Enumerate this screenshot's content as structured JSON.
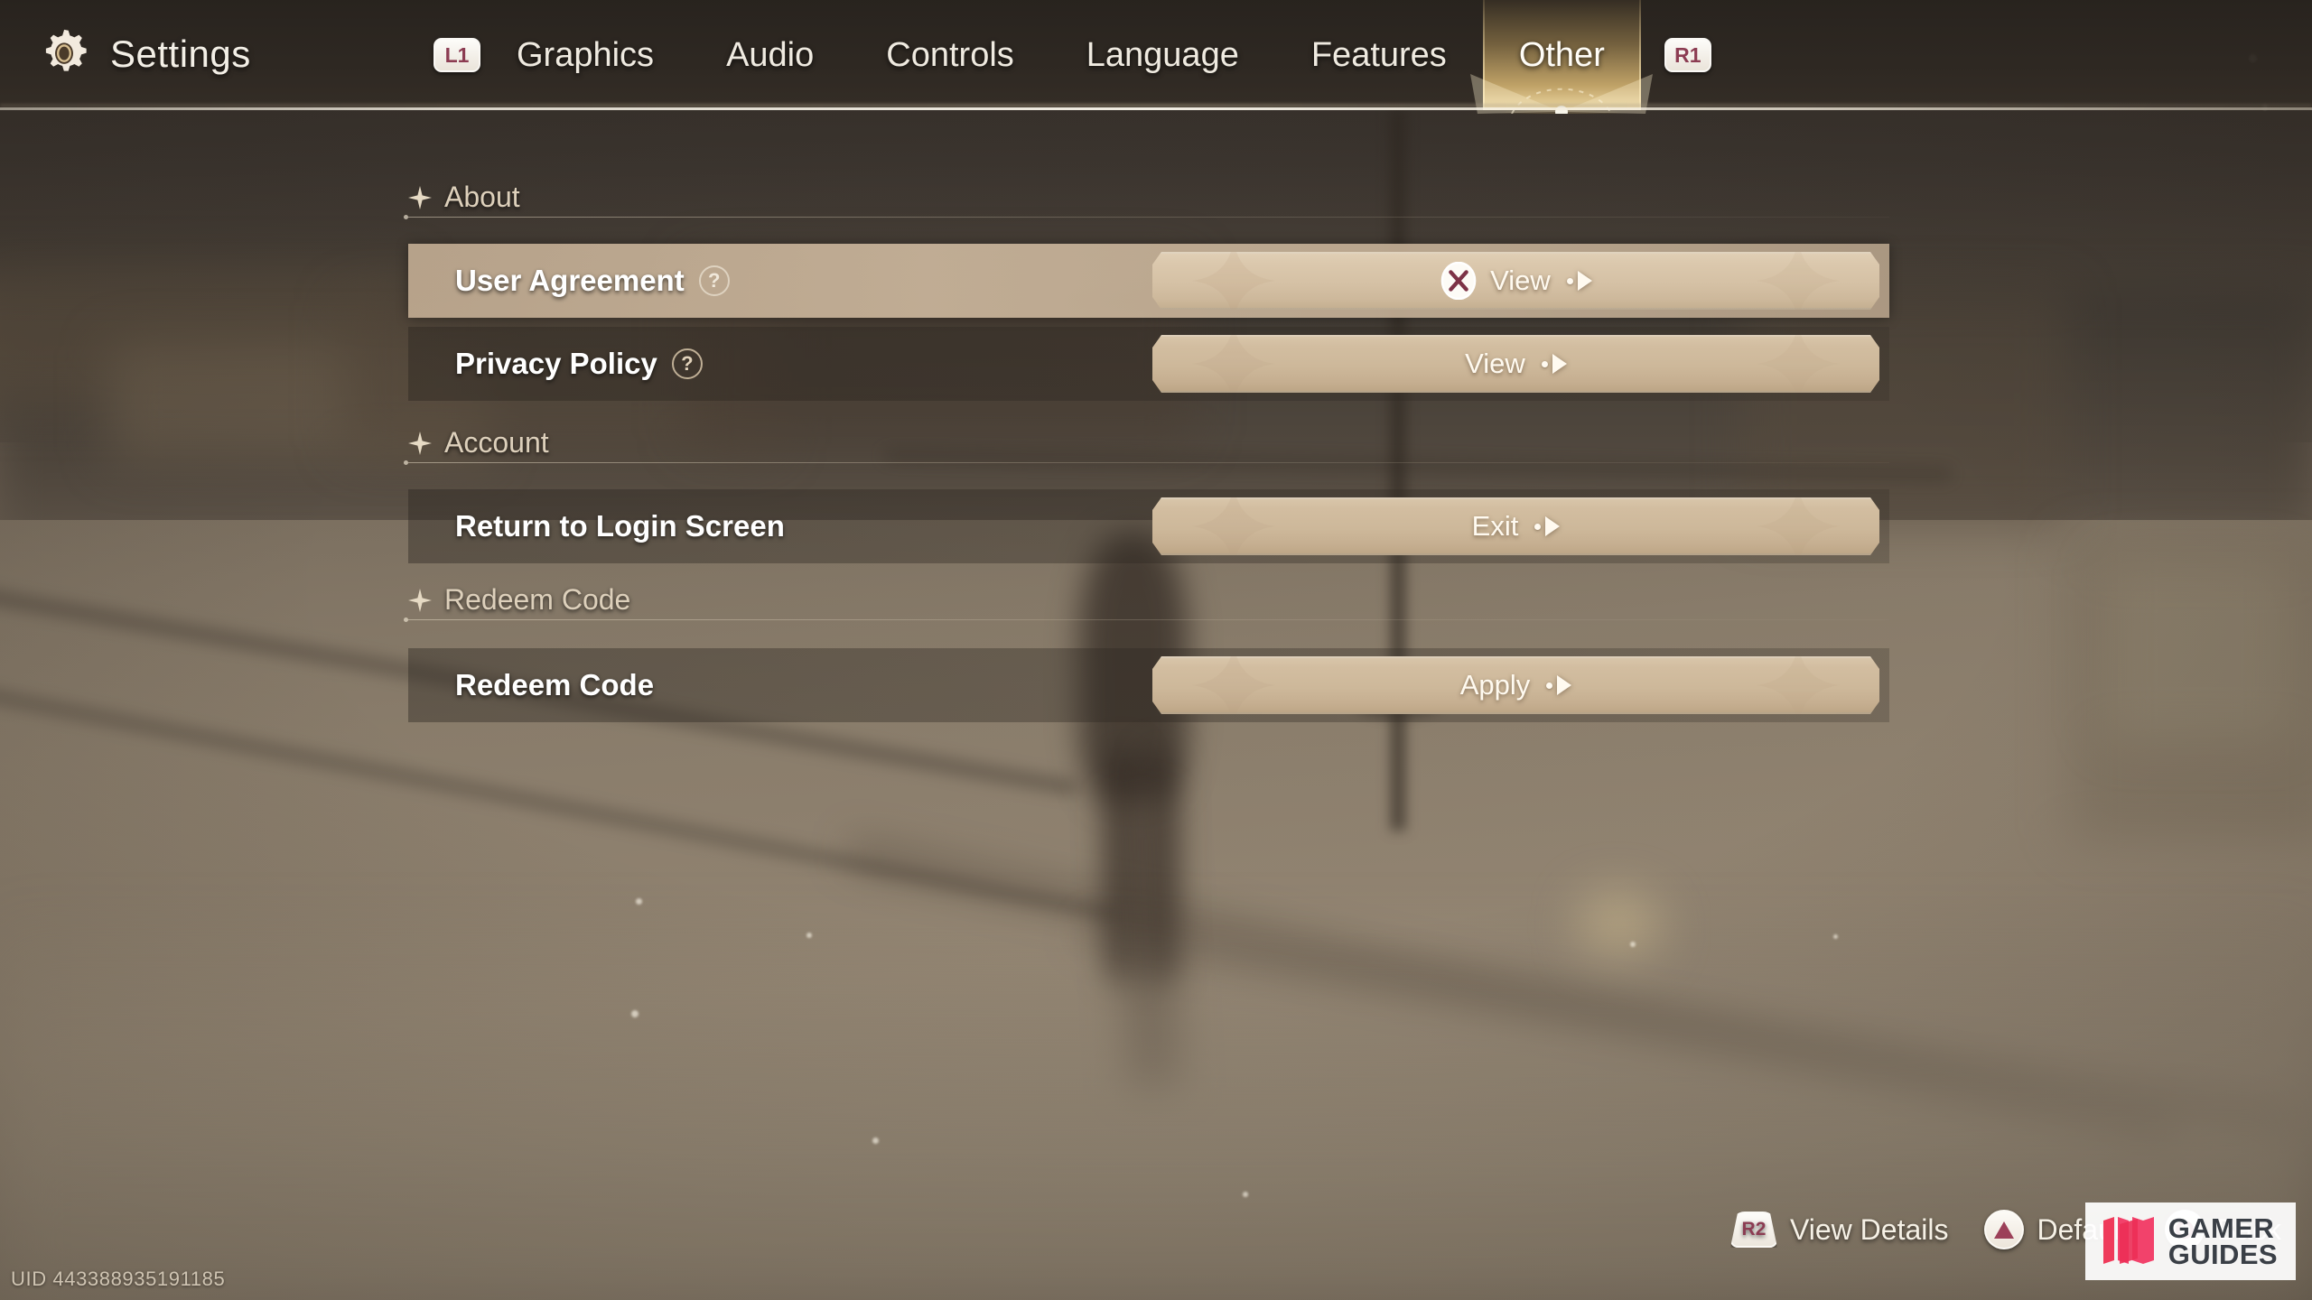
{
  "header": {
    "title": "Settings",
    "gear_icon": "gear-icon",
    "left_bumper": "L1",
    "right_bumper": "R1",
    "tabs": [
      {
        "label": "Graphics",
        "active": false
      },
      {
        "label": "Audio",
        "active": false
      },
      {
        "label": "Controls",
        "active": false
      },
      {
        "label": "Language",
        "active": false
      },
      {
        "label": "Features",
        "active": false
      },
      {
        "label": "Other",
        "active": true
      }
    ]
  },
  "sections": [
    {
      "title": "About",
      "rows": [
        {
          "label": "User Agreement",
          "has_help": true,
          "help_glyph": "?",
          "selected": true,
          "action": {
            "label": "View",
            "button_glyph": "cross-button",
            "show_button_glyph": true,
            "arrow": true
          }
        },
        {
          "label": "Privacy Policy",
          "has_help": true,
          "help_glyph": "?",
          "selected": false,
          "action": {
            "label": "View",
            "button_glyph": "",
            "show_button_glyph": false,
            "arrow": true
          }
        }
      ]
    },
    {
      "title": "Account",
      "rows": [
        {
          "label": "Return to Login Screen",
          "has_help": false,
          "help_glyph": "",
          "selected": false,
          "action": {
            "label": "Exit",
            "button_glyph": "",
            "show_button_glyph": false,
            "arrow": true
          }
        }
      ]
    },
    {
      "title": "Redeem Code",
      "rows": [
        {
          "label": "Redeem Code",
          "has_help": false,
          "help_glyph": "",
          "selected": false,
          "action": {
            "label": "Apply",
            "button_glyph": "",
            "show_button_glyph": false,
            "arrow": true
          }
        }
      ]
    }
  ],
  "footer": {
    "uid": "UID 443388935191185",
    "prompts": [
      {
        "badge": "R2",
        "badge_type": "trigger",
        "label": "View Details"
      },
      {
        "badge": "triangle",
        "badge_type": "round",
        "label": "Default"
      },
      {
        "badge": "circle",
        "badge_type": "round",
        "label": "Back"
      }
    ]
  },
  "watermark": {
    "line1": "GAMER",
    "line2": "GUIDES"
  },
  "colors": {
    "accent_gold": "#e8c47a",
    "button_tan": "#cdb89a",
    "selected_row": "#cdb89e",
    "badge_maroon": "#8c3c52",
    "text_cream": "#f3efe6",
    "section_text": "#ddd0bb"
  }
}
